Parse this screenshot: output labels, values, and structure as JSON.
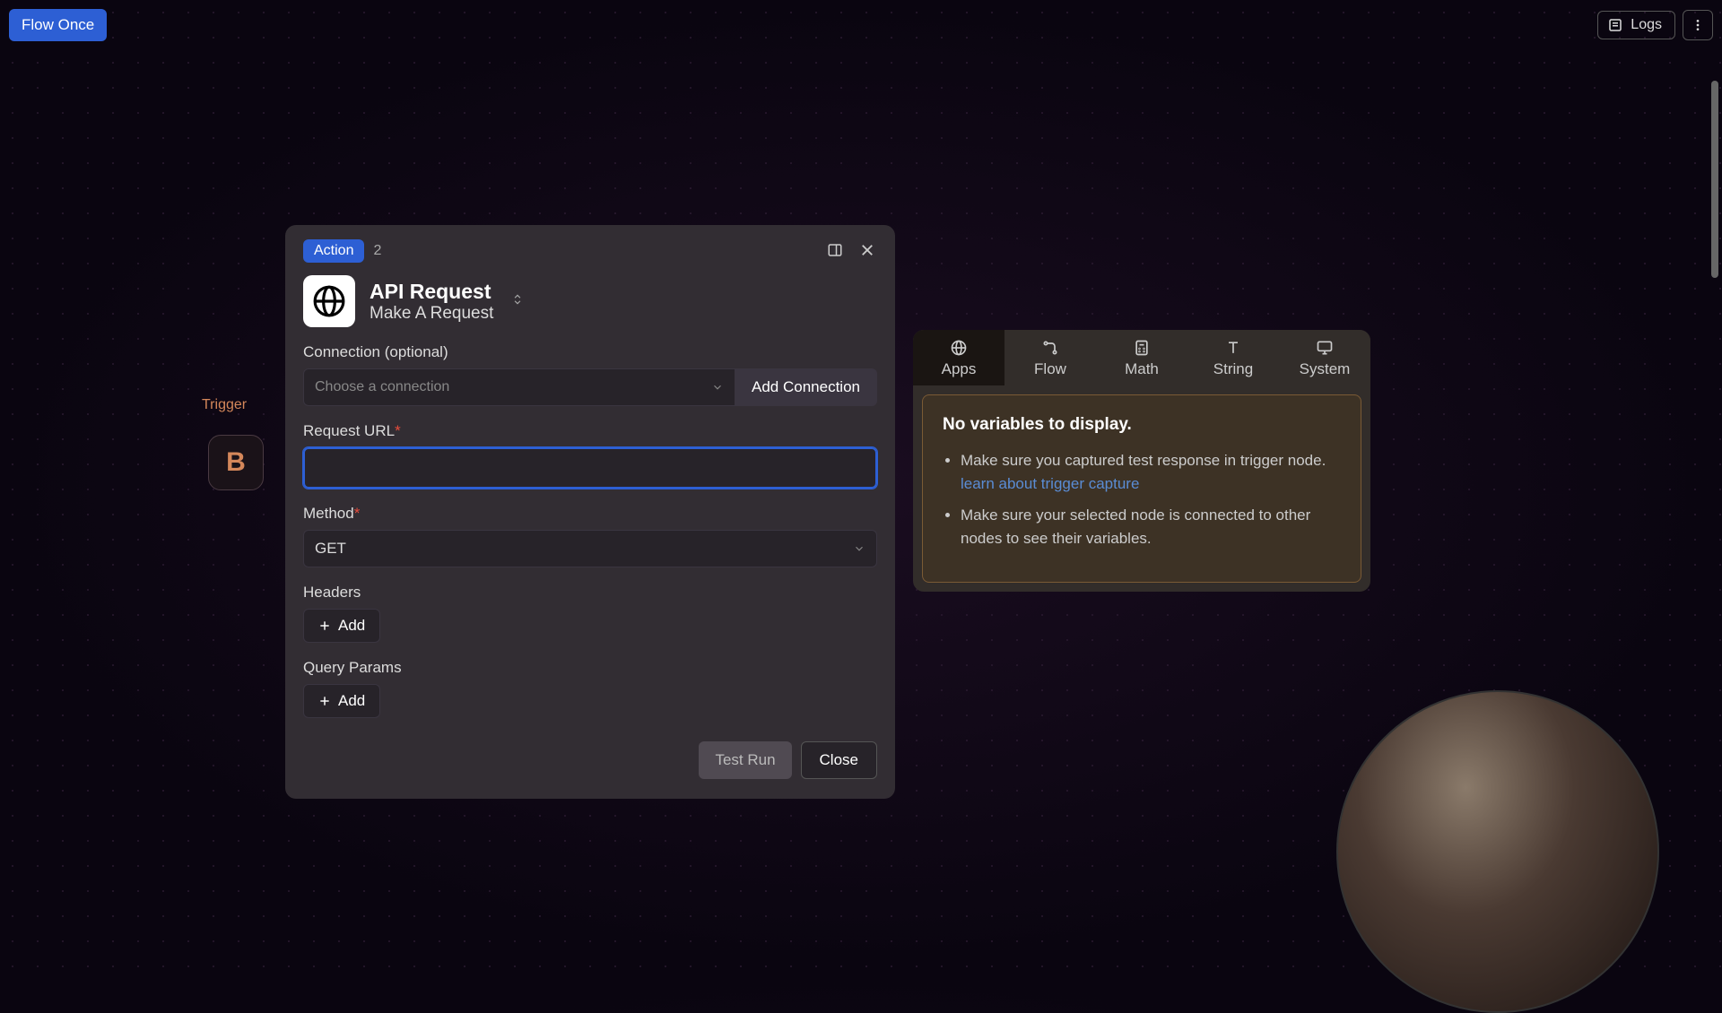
{
  "topbar": {
    "flow_once": "Flow Once",
    "logs": "Logs"
  },
  "canvas": {
    "trigger_label": "Trigger",
    "trigger_icon_letter": "B"
  },
  "modal": {
    "badge": "Action",
    "step": "2",
    "title": "API Request",
    "subtitle": "Make A Request",
    "connection": {
      "label": "Connection (optional)",
      "placeholder": "Choose a connection",
      "add_button": "Add Connection"
    },
    "url": {
      "label": "Request URL",
      "value": ""
    },
    "method": {
      "label": "Method",
      "value": "GET"
    },
    "headers": {
      "label": "Headers",
      "add": "Add"
    },
    "query_params": {
      "label": "Query Params",
      "add": "Add"
    },
    "footer": {
      "test_run": "Test Run",
      "close": "Close"
    }
  },
  "var_panel": {
    "tabs": [
      "Apps",
      "Flow",
      "Math",
      "String",
      "System"
    ],
    "active_tab": 0,
    "heading": "No variables to display.",
    "bullets": [
      {
        "text": "Make sure you captured test response in trigger node. ",
        "link_text": "learn about trigger capture"
      },
      {
        "text": "Make sure your selected node is connected to other nodes to see their variables.",
        "link_text": ""
      }
    ]
  }
}
